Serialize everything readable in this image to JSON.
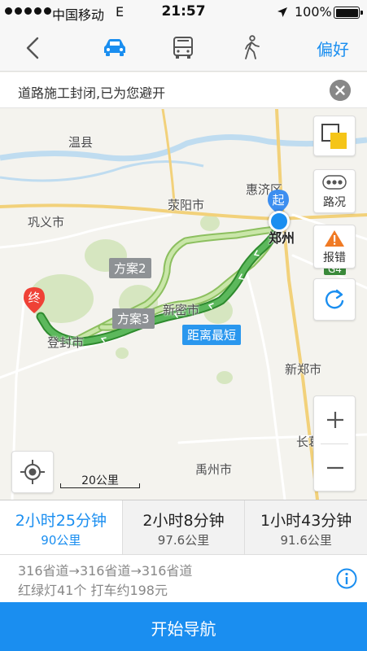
{
  "status_bar": {
    "carrier": "中国移动",
    "network": "E",
    "time": "21:57",
    "battery": "100%"
  },
  "nav": {
    "modes": [
      "car-icon",
      "bus-icon",
      "walk-icon"
    ],
    "active_mode": "car",
    "preference_label": "偏好"
  },
  "notice": {
    "text": "道路施工封闭,已为您避开"
  },
  "map": {
    "places": {
      "wenxian": "温县",
      "huijiqu": "惠济区",
      "xingyang": "荥阳市",
      "gongyi": "巩义市",
      "zhengzhou": "郑州",
      "xinmi": "新密市",
      "dengfeng": "登封市",
      "xinzheng": "新郑市",
      "yuzhou": "禹州市",
      "changge": "长葛"
    },
    "route_labels": {
      "plan2": "方案2",
      "plan3": "方案3",
      "shortest": "距离最短"
    },
    "start_marker": "起",
    "end_marker": "终",
    "road_badge": "G4",
    "buttons": {
      "traffic": "路况",
      "report": "报错"
    },
    "scale": "20公里"
  },
  "routes": [
    {
      "duration": "2小时25分钟",
      "distance": "90公里",
      "active": true
    },
    {
      "duration": "2小时8分钟",
      "distance": "97.6公里",
      "active": false
    },
    {
      "duration": "1小时43分钟",
      "distance": "91.6公里",
      "active": false
    }
  ],
  "detail": {
    "road": "316省道→316省道→316省道",
    "info": "红绿灯41个 打车约198元"
  },
  "start_button": "开始导航",
  "colors": {
    "accent": "#1a8ef0",
    "route_green": "#5cb85c",
    "alt_route": "#a6d88a",
    "marker_red": "#ef4136"
  }
}
